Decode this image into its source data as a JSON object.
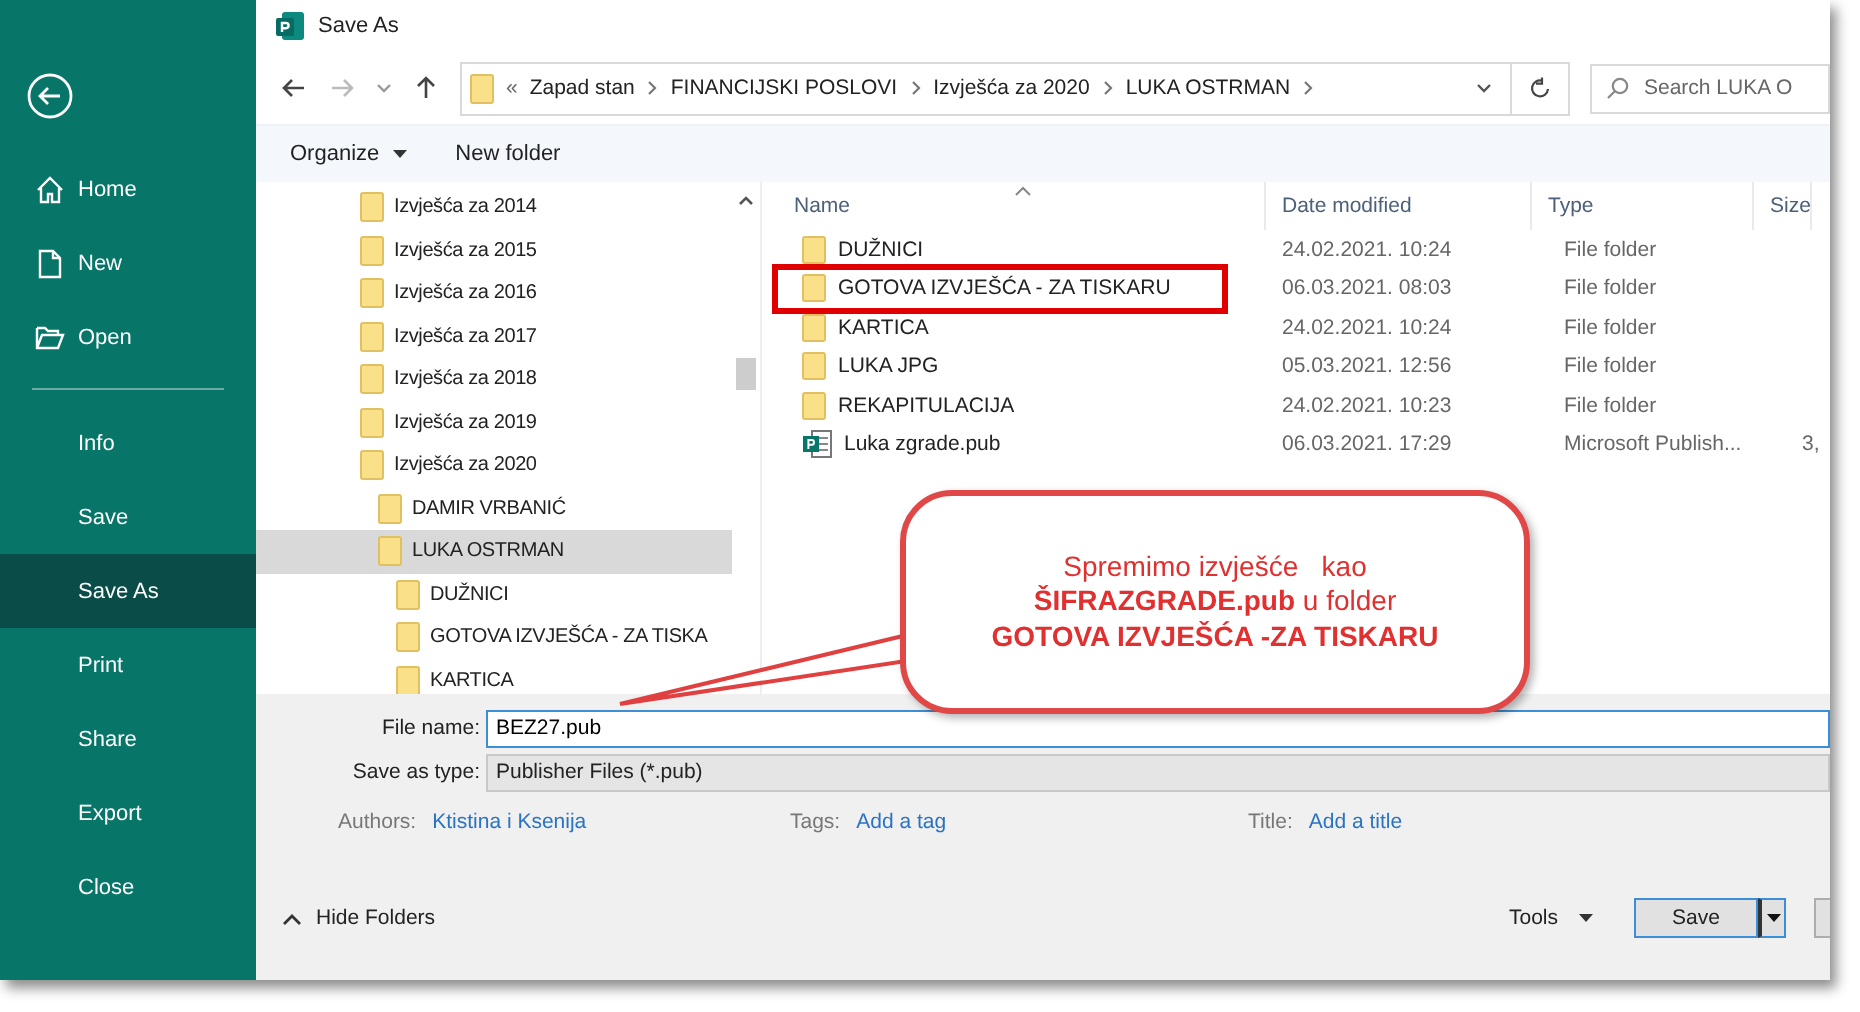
{
  "backstage": {
    "top_items": [
      {
        "label": "Home"
      },
      {
        "label": "New"
      },
      {
        "label": "Open"
      }
    ],
    "items": [
      {
        "label": "Info",
        "selected": false
      },
      {
        "label": "Save",
        "selected": false
      },
      {
        "label": "Save As",
        "selected": true
      },
      {
        "label": "Print",
        "selected": false
      },
      {
        "label": "Share",
        "selected": false
      },
      {
        "label": "Export",
        "selected": false
      },
      {
        "label": "Close",
        "selected": false
      }
    ]
  },
  "dialog": {
    "title": "Save As",
    "address": {
      "overflow": "«",
      "path": [
        "Zapad stan",
        "FINANCIJSKI POSLOVI",
        "Izvješća za 2020",
        "LUKA OSTRMAN"
      ]
    },
    "search": {
      "placeholder": "Search LUKA O"
    },
    "toolbar": {
      "organize": "Organize",
      "new_folder": "New folder"
    },
    "tree": [
      {
        "label": "Izvješća za 2014",
        "selected": false
      },
      {
        "label": "Izvješća za 2015",
        "selected": false
      },
      {
        "label": "Izvješća za 2016",
        "selected": false
      },
      {
        "label": "Izvješća za 2017",
        "selected": false
      },
      {
        "label": "Izvješća za 2018",
        "selected": false
      },
      {
        "label": "Izvješća za 2019",
        "selected": false
      },
      {
        "label": "Izvješća za 2020",
        "selected": false,
        "children": [
          {
            "label": "DAMIR VRBANIĆ",
            "selected": false
          },
          {
            "label": "LUKA OSTRMAN",
            "selected": true,
            "children": [
              {
                "label": "DUŽNICI",
                "selected": false
              },
              {
                "label": "GOTOVA IZVJEŠĆA - ZA TISKA",
                "selected": false
              },
              {
                "label": "KARTICA",
                "selected": false
              }
            ]
          }
        ]
      }
    ],
    "columns": [
      "Name",
      "Date modified",
      "Type",
      "Size"
    ],
    "files": [
      {
        "kind": "folder",
        "name": "DUŽNICI",
        "date": "24.02.2021. 10:24",
        "type": "File folder",
        "highlighted": false
      },
      {
        "kind": "folder",
        "name": "GOTOVA IZVJEŠĆA - ZA TISKARU",
        "date": "06.03.2021. 08:03",
        "type": "File folder",
        "highlighted": true
      },
      {
        "kind": "folder",
        "name": "KARTICA",
        "date": "24.02.2021. 10:24",
        "type": "File folder",
        "highlighted": false
      },
      {
        "kind": "folder",
        "name": "LUKA JPG",
        "date": "05.03.2021. 12:56",
        "type": "File folder",
        "highlighted": false
      },
      {
        "kind": "folder",
        "name": "REKAPITULACIJA",
        "date": "24.02.2021. 10:23",
        "type": "File folder",
        "highlighted": false
      },
      {
        "kind": "publication",
        "name": "Luka zgrade.pub",
        "date": "06.03.2021. 17:29",
        "type": "Microsoft Publish...",
        "size": "3,",
        "highlighted": false
      }
    ],
    "file_name": {
      "label": "File name:",
      "value": "BEZ27.pub"
    },
    "save_as_type": {
      "label": "Save as type:",
      "value": "Publisher Files (*.pub)"
    },
    "meta": [
      {
        "label": "Authors:",
        "value": "Ktistina i Ksenija"
      },
      {
        "label": "Tags:",
        "value": "Add a tag"
      },
      {
        "label": "Title:",
        "value": "Add a title"
      }
    ],
    "hide_folders": "Hide Folders",
    "tools": "Tools",
    "save": "Save"
  },
  "callout": {
    "text": "Spremimo izvješće   kao\n**ŠIFRAZGRADE.pub** u folder\n**GOTOVA IZVJEŠĆA -ZA TISKARU**"
  }
}
